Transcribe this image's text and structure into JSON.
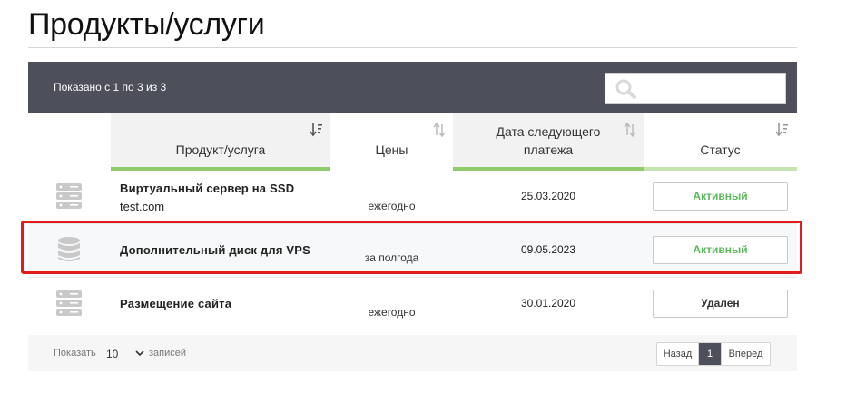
{
  "page": {
    "title": "Продукты/услуги"
  },
  "toolbar": {
    "info": "Показано с 1 по 3 из 3",
    "search_placeholder": ""
  },
  "columns": {
    "product": "Продукт/услуга",
    "price": "Цены",
    "next_payment_line1": "Дата следующего",
    "next_payment_line2": "платежа",
    "status": "Статус"
  },
  "rows": [
    {
      "icon": "server-icon",
      "name": "Виртуальный сервер на SSD",
      "domain": "test.com",
      "price": "ежегодно",
      "date": "25.03.2020",
      "status": "Активный"
    },
    {
      "icon": "database-icon",
      "name": "Дополнительный диск для VPS",
      "domain": "",
      "price": "за полгода",
      "date": "09.05.2023",
      "status": "Активный"
    },
    {
      "icon": "server-icon",
      "name": "Размещение сайта",
      "domain": "",
      "price": "ежегодно",
      "date": "30.01.2020",
      "status": "Удален"
    }
  ],
  "footer": {
    "show_label": "Показать",
    "per_page": "10",
    "entries_label": "записей",
    "prev": "Назад",
    "current_page": "1",
    "next": "Вперед"
  },
  "colors": {
    "toolbar_bg": "#4d505b",
    "active_status": "#5cb85c",
    "sort_accent": "#8fcb6a",
    "highlight": "#e21c1c"
  }
}
